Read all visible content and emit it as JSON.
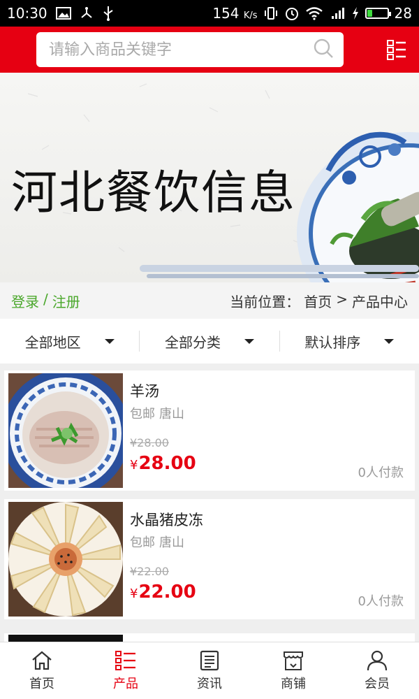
{
  "status_bar": {
    "time": "10:30",
    "speed": "154",
    "speed_unit": "K/s",
    "battery": "28",
    "battery_level": 0.28
  },
  "search": {
    "placeholder": "请输入商品关键字"
  },
  "banner": {
    "title": "河北餐饮信息"
  },
  "crumbs": {
    "login": "登录",
    "sep": "/",
    "register": "注册",
    "position_label": "当前位置：",
    "home": "首页",
    "arrow": ">",
    "current": "产品中心"
  },
  "filters": [
    {
      "label": "全部地区"
    },
    {
      "label": "全部分类"
    },
    {
      "label": "默认排序"
    }
  ],
  "products": [
    {
      "name": "羊汤",
      "shipping": "包邮",
      "city": "唐山",
      "old_price": "¥28.00",
      "currency": "¥",
      "price": "28.00",
      "paid": "0人付款"
    },
    {
      "name": "水晶猪皮冻",
      "shipping": "包邮",
      "city": "唐山",
      "old_price": "¥22.00",
      "currency": "¥",
      "price": "22.00",
      "paid": "0人付款"
    }
  ],
  "tabbar": [
    {
      "label": "首页",
      "icon": "home-icon"
    },
    {
      "label": "产品",
      "icon": "list-icon",
      "active": true
    },
    {
      "label": "资讯",
      "icon": "news-icon"
    },
    {
      "label": "商铺",
      "icon": "shop-icon"
    },
    {
      "label": "会员",
      "icon": "user-icon"
    }
  ],
  "colors": {
    "brand": "#e60012",
    "link_green": "#4aa72b",
    "price_red": "#e60012"
  }
}
